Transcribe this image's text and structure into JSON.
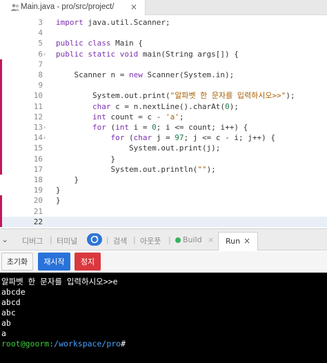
{
  "editor_tab": {
    "title": "Main.java - pro/src/project/",
    "close": "×"
  },
  "code_lines": [
    {
      "num": "3",
      "fold": "",
      "mark": false,
      "active": false,
      "html": "<span class=\"kw\">import</span> java.util.Scanner;"
    },
    {
      "num": "4",
      "fold": "",
      "mark": false,
      "active": false,
      "html": ""
    },
    {
      "num": "5",
      "fold": "",
      "mark": false,
      "active": false,
      "html": "<span class=\"kw\">public class</span> Main {"
    },
    {
      "num": "6",
      "fold": "›",
      "mark": false,
      "active": false,
      "html": "<span class=\"kw\">public static void</span> main(String args[]) {"
    },
    {
      "num": "7",
      "fold": "",
      "mark": true,
      "active": false,
      "html": ""
    },
    {
      "num": "8",
      "fold": "",
      "mark": true,
      "active": false,
      "html": "    Scanner n = <span class=\"kw\">new</span> Scanner(System.in);"
    },
    {
      "num": "9",
      "fold": "",
      "mark": true,
      "active": false,
      "html": ""
    },
    {
      "num": "10",
      "fold": "",
      "mark": true,
      "active": false,
      "html": "        System.out.print(<span class=\"str\">\"알파벳 한 문자를 입력하시오>>\"</span>);"
    },
    {
      "num": "11",
      "fold": "",
      "mark": true,
      "active": false,
      "html": "        <span class=\"kw\">char</span> c = n.nextLine().charAt(<span class=\"num\">0</span>);"
    },
    {
      "num": "12",
      "fold": "",
      "mark": true,
      "active": false,
      "html": "        <span class=\"kw\">int</span> count = c - <span class=\"str\">'a'</span>;"
    },
    {
      "num": "13",
      "fold": "›",
      "mark": true,
      "active": false,
      "html": "        <span class=\"kw\">for</span> (<span class=\"kw\">int</span> i = <span class=\"num\">0</span>; i <= count; i++) {"
    },
    {
      "num": "14",
      "fold": "›",
      "mark": true,
      "active": false,
      "html": "            <span class=\"kw\">for</span> (<span class=\"kw\">char</span> j = <span class=\"num\">97</span>; j <= c - i; j++) {"
    },
    {
      "num": "15",
      "fold": "",
      "mark": true,
      "active": false,
      "html": "                System.out.print(j);"
    },
    {
      "num": "16",
      "fold": "",
      "mark": true,
      "active": false,
      "html": "            }"
    },
    {
      "num": "17",
      "fold": "",
      "mark": true,
      "active": false,
      "html": "            System.out.println(<span class=\"str\">\"\"</span>);"
    },
    {
      "num": "18",
      "fold": "",
      "mark": false,
      "active": false,
      "html": "    }"
    },
    {
      "num": "19",
      "fold": "",
      "mark": false,
      "active": false,
      "html": "}"
    },
    {
      "num": "20",
      "fold": "",
      "mark": true,
      "active": false,
      "html": "}"
    },
    {
      "num": "21",
      "fold": "",
      "mark": true,
      "active": false,
      "html": ""
    },
    {
      "num": "22",
      "fold": "",
      "mark": true,
      "active": true,
      "html": ""
    }
  ],
  "panel": {
    "tabs": [
      "디버그",
      "터미널",
      "검색",
      "아웃풋",
      "Build"
    ],
    "active_tab": "Run",
    "active_close": "×",
    "chevron": "⌄"
  },
  "toolbar": {
    "reset_label": "초기화",
    "restart_label": "재시작",
    "stop_label": "정지"
  },
  "terminal": {
    "lines": [
      "알파벳 한 문자를 입력하시오>>e",
      "abcde",
      "abcd",
      "abc",
      "ab",
      "a"
    ],
    "prompt_user": "root@goorm",
    "prompt_path": ":/workspace/pro",
    "prompt_end": "#"
  },
  "colors": {
    "accent": "#2a72d9",
    "stop": "#d9393e",
    "change_marker": "#c2185b",
    "terminal_bg": "#000000"
  }
}
